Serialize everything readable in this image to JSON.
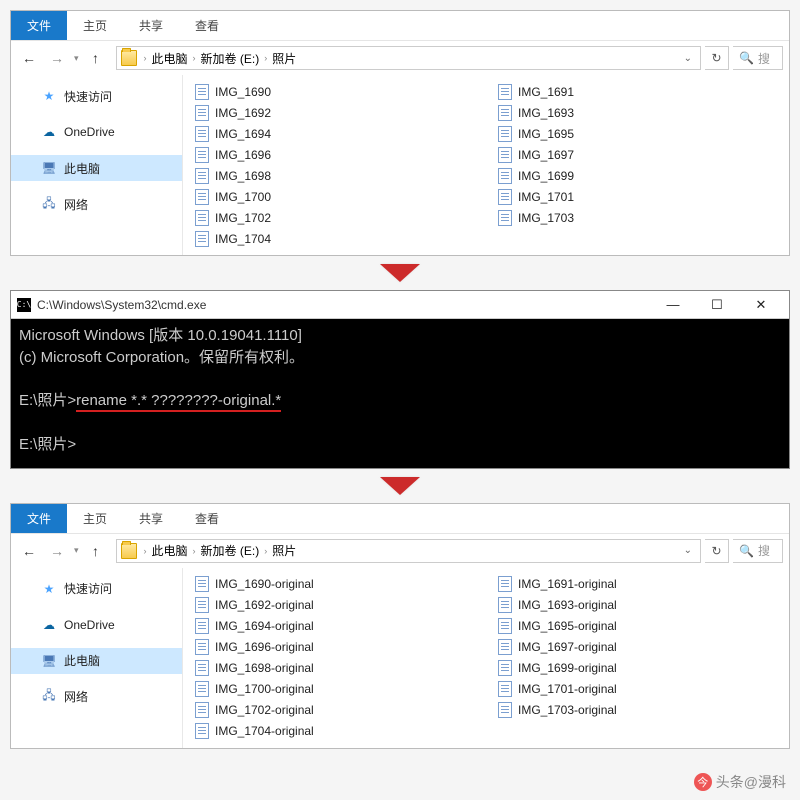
{
  "ribbon": {
    "file": "文件",
    "home": "主页",
    "share": "共享",
    "view": "查看"
  },
  "breadcrumbs": {
    "thisPC": "此电脑",
    "volume": "新加卷 (E:)",
    "photos": "照片"
  },
  "search": {
    "placeholder": "搜"
  },
  "sidebar": {
    "quickAccess": "快速访问",
    "onedrive": "OneDrive",
    "thisPC": "此电脑",
    "network": "网络"
  },
  "files_before": {
    "col1": [
      "IMG_1690",
      "IMG_1692",
      "IMG_1694",
      "IMG_1696",
      "IMG_1698",
      "IMG_1700",
      "IMG_1702",
      "IMG_1704"
    ],
    "col2": [
      "IMG_1691",
      "IMG_1693",
      "IMG_1695",
      "IMG_1697",
      "IMG_1699",
      "IMG_1701",
      "IMG_1703"
    ]
  },
  "files_after": {
    "col1": [
      "IMG_1690-original",
      "IMG_1692-original",
      "IMG_1694-original",
      "IMG_1696-original",
      "IMG_1698-original",
      "IMG_1700-original",
      "IMG_1702-original",
      "IMG_1704-original"
    ],
    "col2": [
      "IMG_1691-original",
      "IMG_1693-original",
      "IMG_1695-original",
      "IMG_1697-original",
      "IMG_1699-original",
      "IMG_1701-original",
      "IMG_1703-original"
    ]
  },
  "cmd": {
    "title": "C:\\Windows\\System32\\cmd.exe",
    "line1": "Microsoft Windows [版本 10.0.19041.1110]",
    "line2": "(c) Microsoft Corporation。保留所有权利。",
    "prompt1": "E:\\照片>",
    "command": "rename *.* ????????-original.*",
    "prompt2": "E:\\照片>"
  },
  "watermark": "头条@漫科"
}
